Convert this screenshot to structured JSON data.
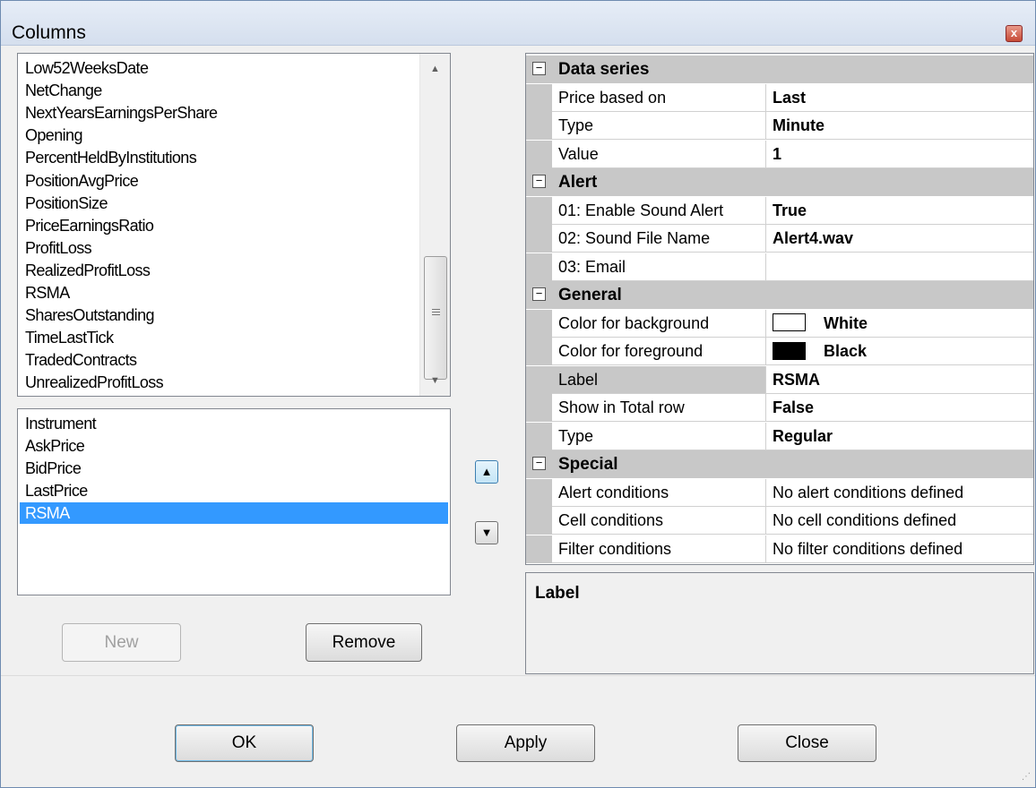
{
  "window": {
    "title": "Columns",
    "close_glyph": "x"
  },
  "available_columns": [
    "Low52WeeksDate",
    "NetChange",
    "NextYearsEarningsPerShare",
    "Opening",
    "PercentHeldByInstitutions",
    "PositionAvgPrice",
    "PositionSize",
    "PriceEarningsRatio",
    "ProfitLoss",
    "RealizedProfitLoss",
    "RSMA",
    "SharesOutstanding",
    "TimeLastTick",
    "TradedContracts",
    "UnrealizedProfitLoss"
  ],
  "selected_columns": {
    "items": [
      "Instrument",
      "AskPrice",
      "BidPrice",
      "LastPrice",
      "RSMA"
    ],
    "selected_index": 4
  },
  "buttons": {
    "new": "New",
    "remove": "Remove",
    "ok": "OK",
    "apply": "Apply",
    "close": "Close"
  },
  "properties": {
    "categories": [
      {
        "name": "Data series",
        "toggle": "⊟",
        "rows": [
          {
            "name": "Price based on",
            "value": "Last",
            "bold": true
          },
          {
            "name": "Type",
            "value": "Minute",
            "bold": true
          },
          {
            "name": "Value",
            "value": "1",
            "bold": true
          }
        ]
      },
      {
        "name": "Alert",
        "toggle": "⊟",
        "rows": [
          {
            "name": "01: Enable Sound Alert",
            "value": "True",
            "bold": true
          },
          {
            "name": "02: Sound File Name",
            "value": "Alert4.wav",
            "bold": true
          },
          {
            "name": "03: Email",
            "value": "",
            "bold": false
          }
        ]
      },
      {
        "name": "General",
        "toggle": "⊟",
        "rows": [
          {
            "name": "Color for background",
            "value": "White",
            "bold": true,
            "swatch": "#ffffff"
          },
          {
            "name": "Color for foreground",
            "value": "Black",
            "bold": true,
            "swatch": "#000000"
          },
          {
            "name": "Label",
            "value": "RSMA",
            "bold": true,
            "selected": true
          },
          {
            "name": "Show in Total row",
            "value": "False",
            "bold": true
          },
          {
            "name": "Type",
            "value": "Regular",
            "bold": true
          }
        ]
      },
      {
        "name": "Special",
        "toggle": "⊟",
        "rows": [
          {
            "name": "Alert conditions",
            "value": "No alert conditions defined",
            "bold": false
          },
          {
            "name": "Cell conditions",
            "value": "No cell conditions defined",
            "bold": false
          },
          {
            "name": "Filter conditions",
            "value": "No filter conditions defined",
            "bold": false
          }
        ]
      }
    ]
  },
  "help": {
    "title": "Label"
  },
  "icons": {
    "scroll_up": "▲",
    "scroll_down": "▼",
    "move_up": "▲",
    "move_down": "▼"
  },
  "colors": {
    "selection": "#3399ff",
    "category_bg": "#c8c8c8"
  }
}
